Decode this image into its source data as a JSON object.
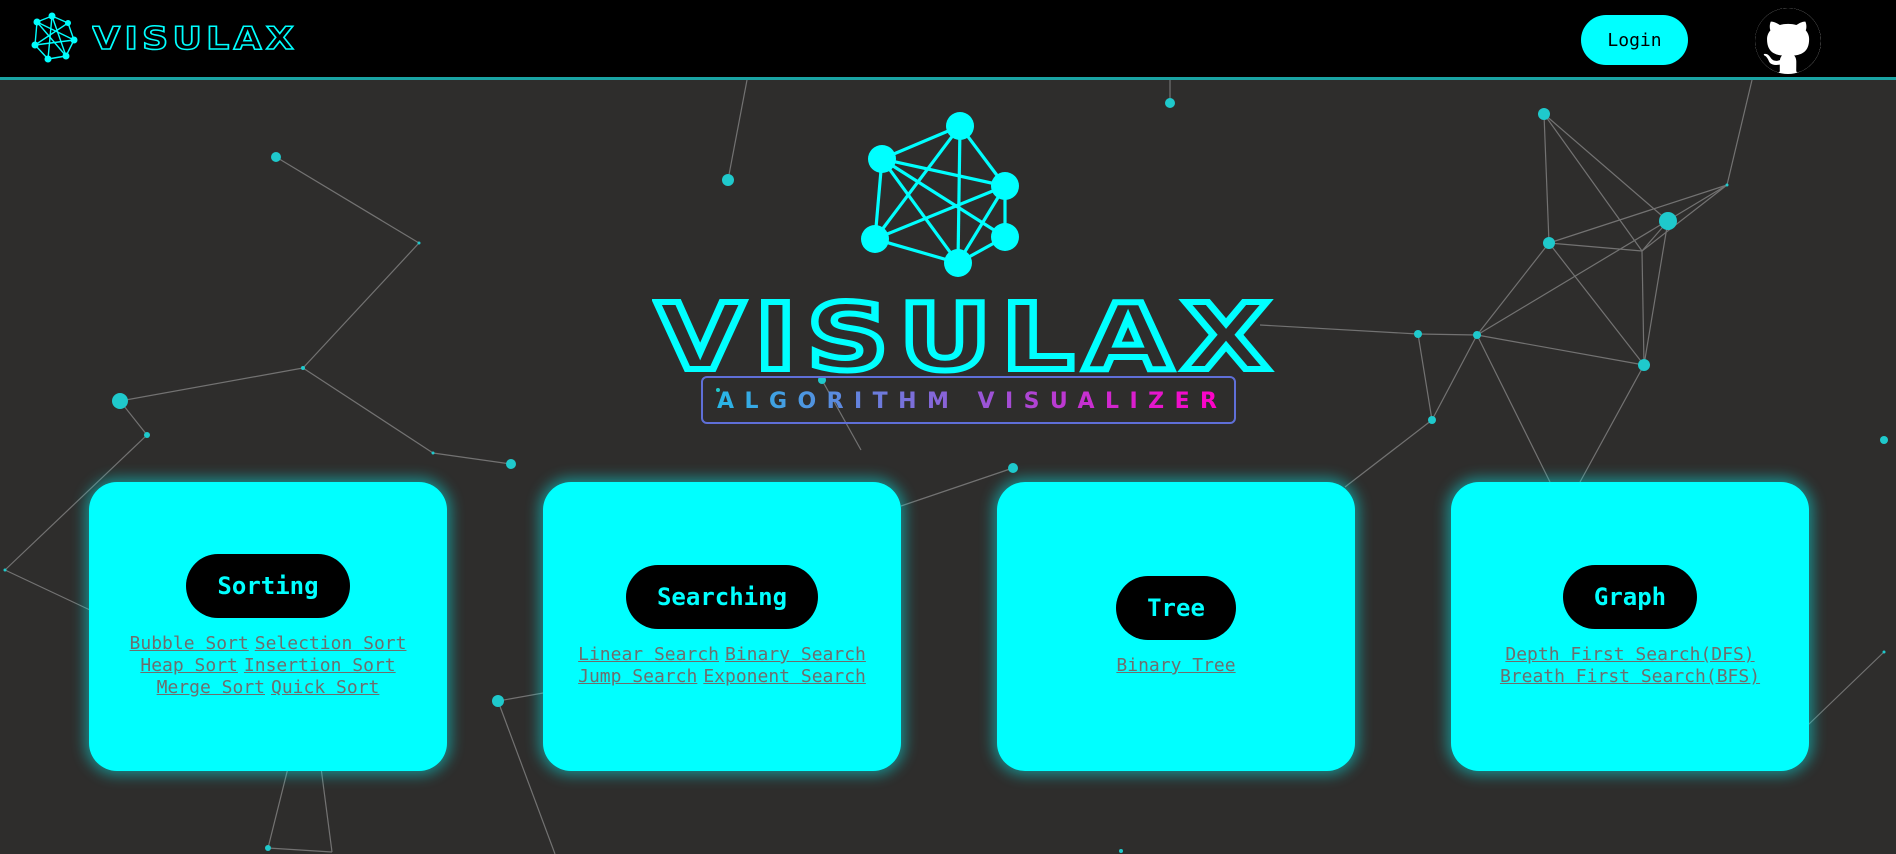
{
  "app": {
    "brand": "VISULAX",
    "tagline": "ALGORITHM VISUALIZER"
  },
  "navbar": {
    "login_label": "Login",
    "github_icon": "github-icon",
    "logo_icon": "network-graph-icon"
  },
  "colors": {
    "accent": "#00ffff",
    "background": "#2e2d2c",
    "navbar": "#000000",
    "tagline_gradient_start": "#27b6e6",
    "tagline_gradient_end": "#ff00c8",
    "link": "#6e6e6e"
  },
  "categories": [
    {
      "title": "Sorting",
      "links": [
        "Bubble Sort",
        "Selection Sort",
        "Heap Sort",
        "Insertion Sort",
        "Merge Sort",
        "Quick Sort"
      ]
    },
    {
      "title": "Searching",
      "links": [
        "Linear Search",
        "Binary Search",
        "Jump Search",
        "Exponent Search"
      ]
    },
    {
      "title": "Tree",
      "links": [
        "Binary Tree"
      ]
    },
    {
      "title": "Graph",
      "links": [
        "Depth First Search(DFS)",
        "Breath First Search(BFS)"
      ]
    }
  ]
}
